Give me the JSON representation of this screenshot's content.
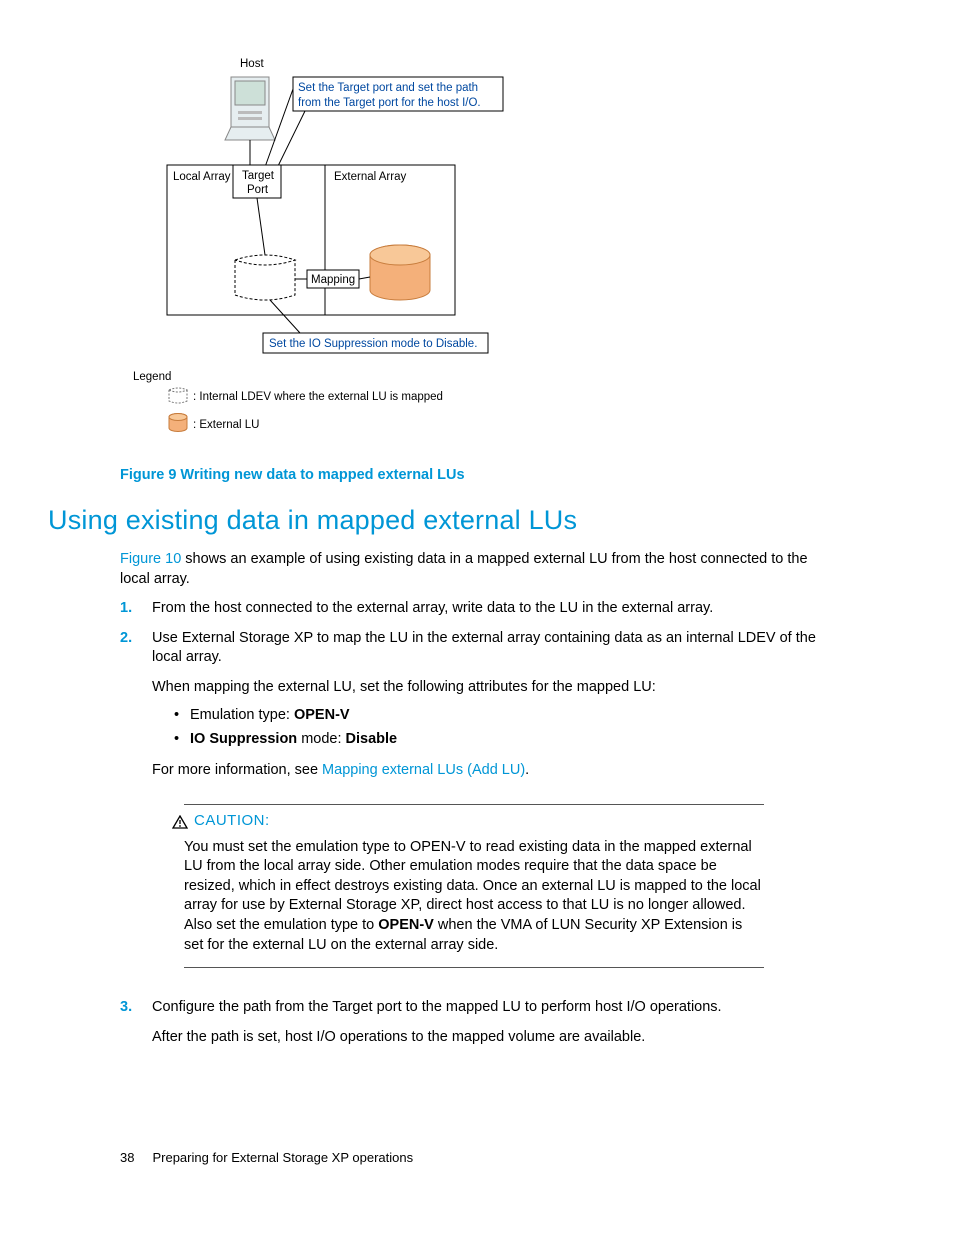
{
  "diagram": {
    "host": "Host",
    "callout1_l1": "Set the Target port and set the path",
    "callout1_l2": "from the Target port for the host I/O.",
    "local_array": "Local Array",
    "target_port_l1": "Target",
    "target_port_l2": "Port",
    "external_array": "External Array",
    "mapping": "Mapping",
    "callout2": "Set the IO Suppression mode to Disable.",
    "legend_title": "Legend",
    "legend_internal": ": Internal LDEV where the external LU is mapped",
    "legend_external": ": External LU"
  },
  "figure_caption": "Figure 9 Writing new data to mapped external LUs",
  "section_title": "Using existing data in mapped external LUs",
  "intro": {
    "link": "Figure 10",
    "rest": " shows an example of using existing data in a mapped external LU from the host connected to the local array."
  },
  "step1": "From the host connected to the external array, write data to the LU in the external array.",
  "step2_a": "Use External Storage XP to map the LU in the external array containing data as an internal LDEV of the local array.",
  "step2_b": "When mapping the external LU, set the following attributes for the mapped LU:",
  "bullet1_pre": "Emulation type: ",
  "bullet1_bold": "OPEN-V",
  "bullet2_bold": "IO Suppression",
  "bullet2_mid": " mode: ",
  "bullet2_bold2": "Disable",
  "step2_c_pre": "For more information, see ",
  "step2_c_link": "Mapping external LUs (Add LU)",
  "step2_c_post": ".",
  "caution_label": "CAUTION:",
  "caution_pre": "You must set the emulation type to OPEN-V to read existing data in the mapped external LU from the local array side. Other emulation modes require that the data space be resized, which in effect destroys existing data. Once an external LU is mapped to the local array for use by External Storage XP, direct host access to that LU is no longer allowed. Also set the emulation type to ",
  "caution_bold": "OPEN-V",
  "caution_post": " when the VMA of LUN Security XP Extension is set for the external LU on the external array side.",
  "step3_a": "Configure the path from the Target port to the mapped LU to perform host I/O operations.",
  "step3_b": "After the path is set, host I/O operations to the mapped volume are available.",
  "footer_page": "38",
  "footer_text": "Preparing for External Storage XP operations"
}
